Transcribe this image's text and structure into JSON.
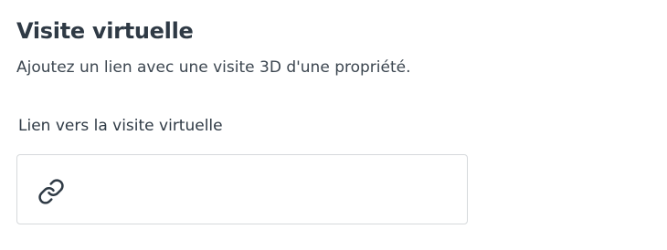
{
  "section": {
    "title": "Visite virtuelle",
    "description": "Ajoutez un lien avec une visite 3D d'une propriété."
  },
  "field": {
    "label": "Lien vers la visite virtuelle",
    "value": "",
    "placeholder": "",
    "icon": "link-icon"
  }
}
